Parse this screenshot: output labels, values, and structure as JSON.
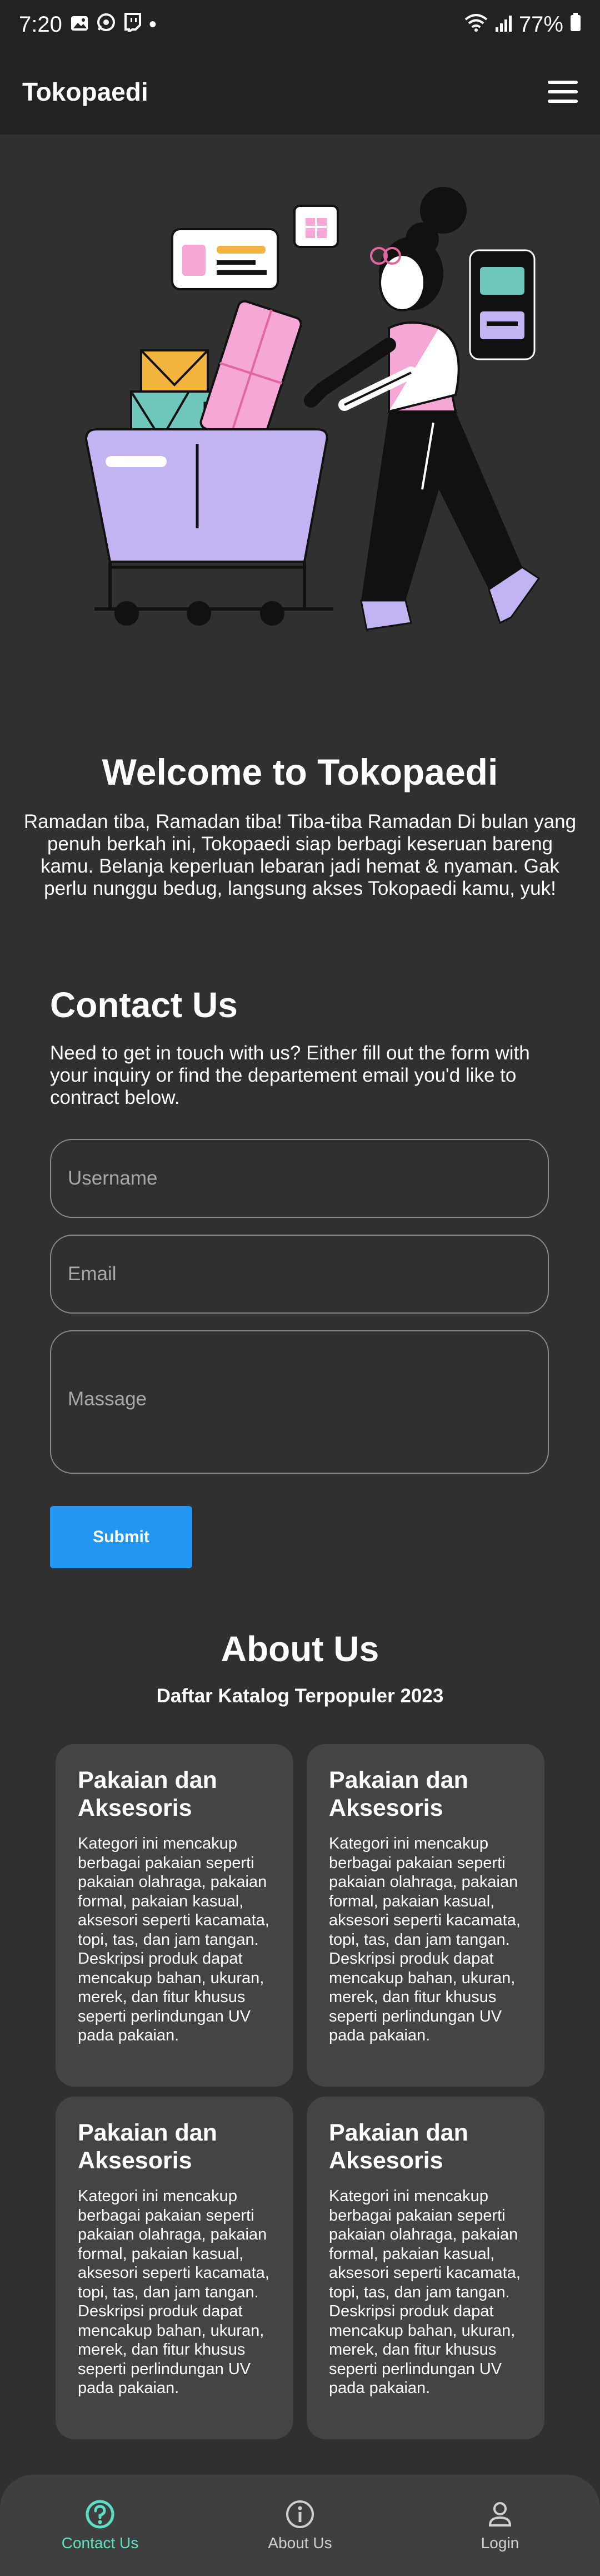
{
  "statusbar": {
    "time": "7:20",
    "dot": "•",
    "battery": "77%"
  },
  "appbar": {
    "title": "Tokopaedi"
  },
  "hero": {
    "title": "Welcome to Tokopaedi",
    "text": "Ramadan tiba, Ramadan tiba! Tiba-tiba Ramadan Di bulan yang penuh berkah ini, Tokopaedi siap berbagi keseruan bareng kamu. Belanja keperluan lebaran jadi hemat & nyaman. Gak perlu nunggu bedug, langsung akses Tokopaedi kamu, yuk!"
  },
  "contact": {
    "title": "Contact Us",
    "text": "Need to get in touch with us? Either fill out the form with your inquiry or find the departement email you'd like to contract below.",
    "username_placeholder": "Username",
    "email_placeholder": "Email",
    "message_placeholder": "Massage",
    "submit_label": "Submit"
  },
  "about": {
    "title": "About Us",
    "subtitle": "Daftar Katalog Terpopuler 2023",
    "cards": [
      {
        "title": "Pakaian dan Aksesoris",
        "text": "Kategori ini mencakup berbagai pakaian seperti pakaian olahraga, pakaian formal, pakaian kasual, aksesori seperti kacamata, topi, tas, dan jam tangan. Deskripsi produk dapat mencakup bahan, ukuran, merek, dan fitur khusus seperti perlindungan UV pada pakaian."
      },
      {
        "title": "Pakaian dan Aksesoris",
        "text": "Kategori ini mencakup berbagai pakaian seperti pakaian olahraga, pakaian formal, pakaian kasual, aksesori seperti kacamata, topi, tas, dan jam tangan. Deskripsi produk dapat mencakup bahan, ukuran, merek, dan fitur khusus seperti perlindungan UV pada pakaian."
      },
      {
        "title": "Pakaian dan Aksesoris",
        "text": "Kategori ini mencakup berbagai pakaian seperti pakaian olahraga, pakaian formal, pakaian kasual, aksesori seperti kacamata, topi, tas, dan jam tangan. Deskripsi produk dapat mencakup bahan, ukuran, merek, dan fitur khusus seperti perlindungan UV pada pakaian."
      },
      {
        "title": "Pakaian dan Aksesoris",
        "text": "Kategori ini mencakup berbagai pakaian seperti pakaian olahraga, pakaian formal, pakaian kasual, aksesori seperti kacamata, topi, tas, dan jam tangan. Deskripsi produk dapat mencakup bahan, ukuran, merek, dan fitur khusus seperti perlindungan UV pada pakaian."
      }
    ]
  },
  "bottomnav": {
    "items": [
      {
        "label": "Contact Us",
        "icon": "help-circle-icon",
        "active": true
      },
      {
        "label": "About Us",
        "icon": "info-circle-icon",
        "active": false
      },
      {
        "label": "Login",
        "icon": "person-icon",
        "active": false
      }
    ]
  },
  "colors": {
    "background": "#303030",
    "appbar": "#222222",
    "accent_button": "#2196f3",
    "nav_active": "#5ce1c6",
    "card": "#444444"
  }
}
